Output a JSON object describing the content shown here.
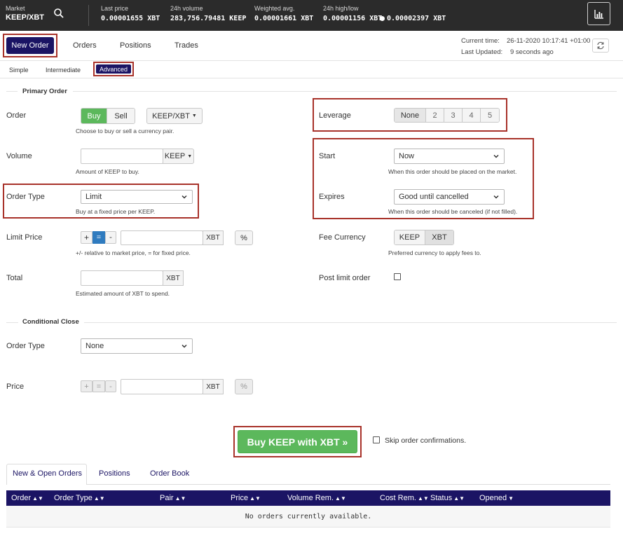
{
  "topbar": {
    "market_label": "Market",
    "market_value": "KEEP/XBT",
    "stats": [
      {
        "label": "Last price",
        "value": "0.00001655 XBT"
      },
      {
        "label": "24h volume",
        "value": "283,756.79481 KEEP"
      },
      {
        "label": "Weighted avg.",
        "value": "0.00001661 XBT"
      },
      {
        "label": "24h high/low",
        "value": "0.00001156 XBT",
        "value2": "0.00002397 XBT"
      }
    ],
    "icons": {
      "search": "search-icon",
      "chart": "bar-chart-icon"
    }
  },
  "nav": {
    "tabs": [
      "New Order",
      "Orders",
      "Positions",
      "Trades"
    ],
    "current_time_label": "Current time:",
    "current_time_value": "26-11-2020 10:17:41 +01:00",
    "last_updated_label": "Last Updated:",
    "last_updated_value": "9 seconds ago"
  },
  "subtabs": [
    "Simple",
    "Intermediate",
    "Advanced"
  ],
  "primary": {
    "title": "Primary Order",
    "order_label": "Order",
    "buy": "Buy",
    "sell": "Sell",
    "pair": "KEEP/XBT",
    "order_help": "Choose to buy or sell a currency pair.",
    "volume_label": "Volume",
    "volume_currency": "KEEP",
    "volume_help": "Amount of KEEP to buy.",
    "order_type_label": "Order Type",
    "order_type_value": "Limit",
    "order_type_help": "Buy at a fixed price per KEEP.",
    "limit_label": "Limit Price",
    "limit_plus": "+",
    "limit_eq": "=",
    "limit_minus": "-",
    "limit_currency": "XBT",
    "limit_pct": "%",
    "limit_help": "+/- relative to market price, = for fixed price.",
    "total_label": "Total",
    "total_currency": "XBT",
    "total_help": "Estimated amount of XBT to spend."
  },
  "right": {
    "leverage_label": "Leverage",
    "leverage_options": [
      "None",
      "2",
      "3",
      "4",
      "5"
    ],
    "start_label": "Start",
    "start_value": "Now",
    "start_help": "When this order should be placed on the market.",
    "expires_label": "Expires",
    "expires_value": "Good until cancelled",
    "expires_help": "When this order should be canceled (if not filled).",
    "fee_label": "Fee Currency",
    "fee_options": [
      "KEEP",
      "XBT"
    ],
    "fee_help": "Preferred currency to apply fees to.",
    "post_limit_label": "Post limit order"
  },
  "conditional": {
    "title": "Conditional Close",
    "order_type_label": "Order Type",
    "order_type_value": "None",
    "price_label": "Price",
    "plus": "+",
    "eq": "=",
    "minus": "-",
    "currency": "XBT",
    "pct": "%"
  },
  "submit": {
    "buy_label": "Buy KEEP with XBT »",
    "skip_label": "Skip order confirmations."
  },
  "bottom": {
    "tabs": [
      "New & Open Orders",
      "Positions",
      "Order Book"
    ],
    "columns": [
      "Order",
      "Order Type",
      "Pair",
      "Price",
      "Volume Rem.",
      "Cost Rem.",
      "Status",
      "Opened"
    ],
    "empty": "No orders currently available."
  },
  "colors": {
    "navy": "#1b1464",
    "green": "#5cb85c",
    "highlight": "#a8322a",
    "topbar": "#2b2b2b"
  }
}
